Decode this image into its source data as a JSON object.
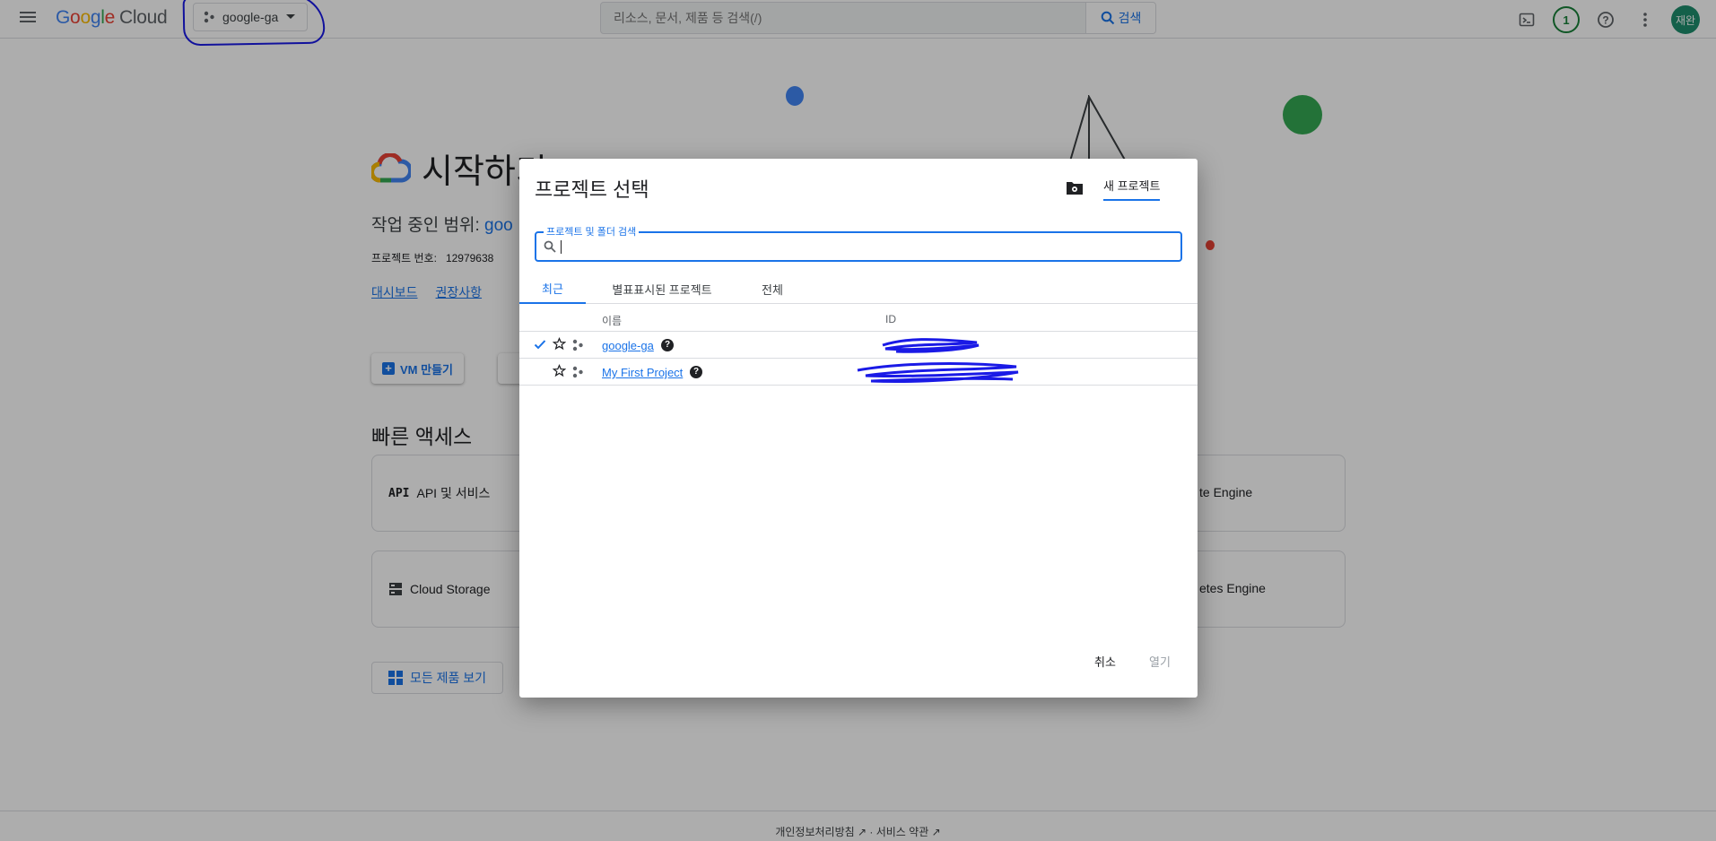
{
  "topbar": {
    "brand_letters": [
      "G",
      "o",
      "o",
      "g",
      "l",
      "e"
    ],
    "brand_suffix": "Cloud",
    "project_picker": "google-ga",
    "search_placeholder": "리소스, 문서, 제품 등 검색(/)",
    "search_button": "검색",
    "notification_count": "1",
    "avatar_text": "재완"
  },
  "background": {
    "title": "시작하기",
    "scope_label": "작업 중인 범위:",
    "scope_value": "goo",
    "project_number_label": "프로젝트 번호:",
    "project_number_value": "12979638",
    "links": [
      "대시보드",
      "권장사항"
    ],
    "vm_button": "VM 만들기",
    "quick_access_title": "빠른 액세스",
    "cards": [
      "API 및 서비스",
      "Cloud Storage",
      "te Engine",
      "etes Engine"
    ],
    "all_products_button": "모든 제품 보기",
    "footer_privacy": "개인정보처리방침",
    "footer_terms": "서비스 약관"
  },
  "dialog": {
    "title": "프로젝트 선택",
    "new_project": "새 프로젝트",
    "search_label": "프로젝트 및 폴더 검색",
    "search_value": "",
    "tabs": [
      "최근",
      "별표표시된 프로젝트",
      "전체"
    ],
    "active_tab": "최근",
    "columns": {
      "name": "이름",
      "id": "ID"
    },
    "rows": [
      {
        "name": "google-ga",
        "selected": true,
        "id": "[redacted]"
      },
      {
        "name": "My First Project",
        "selected": false,
        "id": "[redacted]"
      }
    ],
    "cancel": "취소",
    "open": "열기"
  },
  "icons": {
    "menu": "hamburger-menu-icon",
    "project": "project-nodes-icon",
    "dropdown": "caret-down-icon",
    "search": "search-icon",
    "terminal": "cloud-shell-icon",
    "help": "help-icon",
    "more": "more-vert-icon",
    "folder": "folder-settings-icon",
    "check": "check-icon",
    "star": "star-outline-icon"
  },
  "colors": {
    "accent": "#1a73e8",
    "badge_green": "#188038",
    "avatar_bg": "#1e8e6e",
    "annotation_blue": "#1a1ae6"
  }
}
